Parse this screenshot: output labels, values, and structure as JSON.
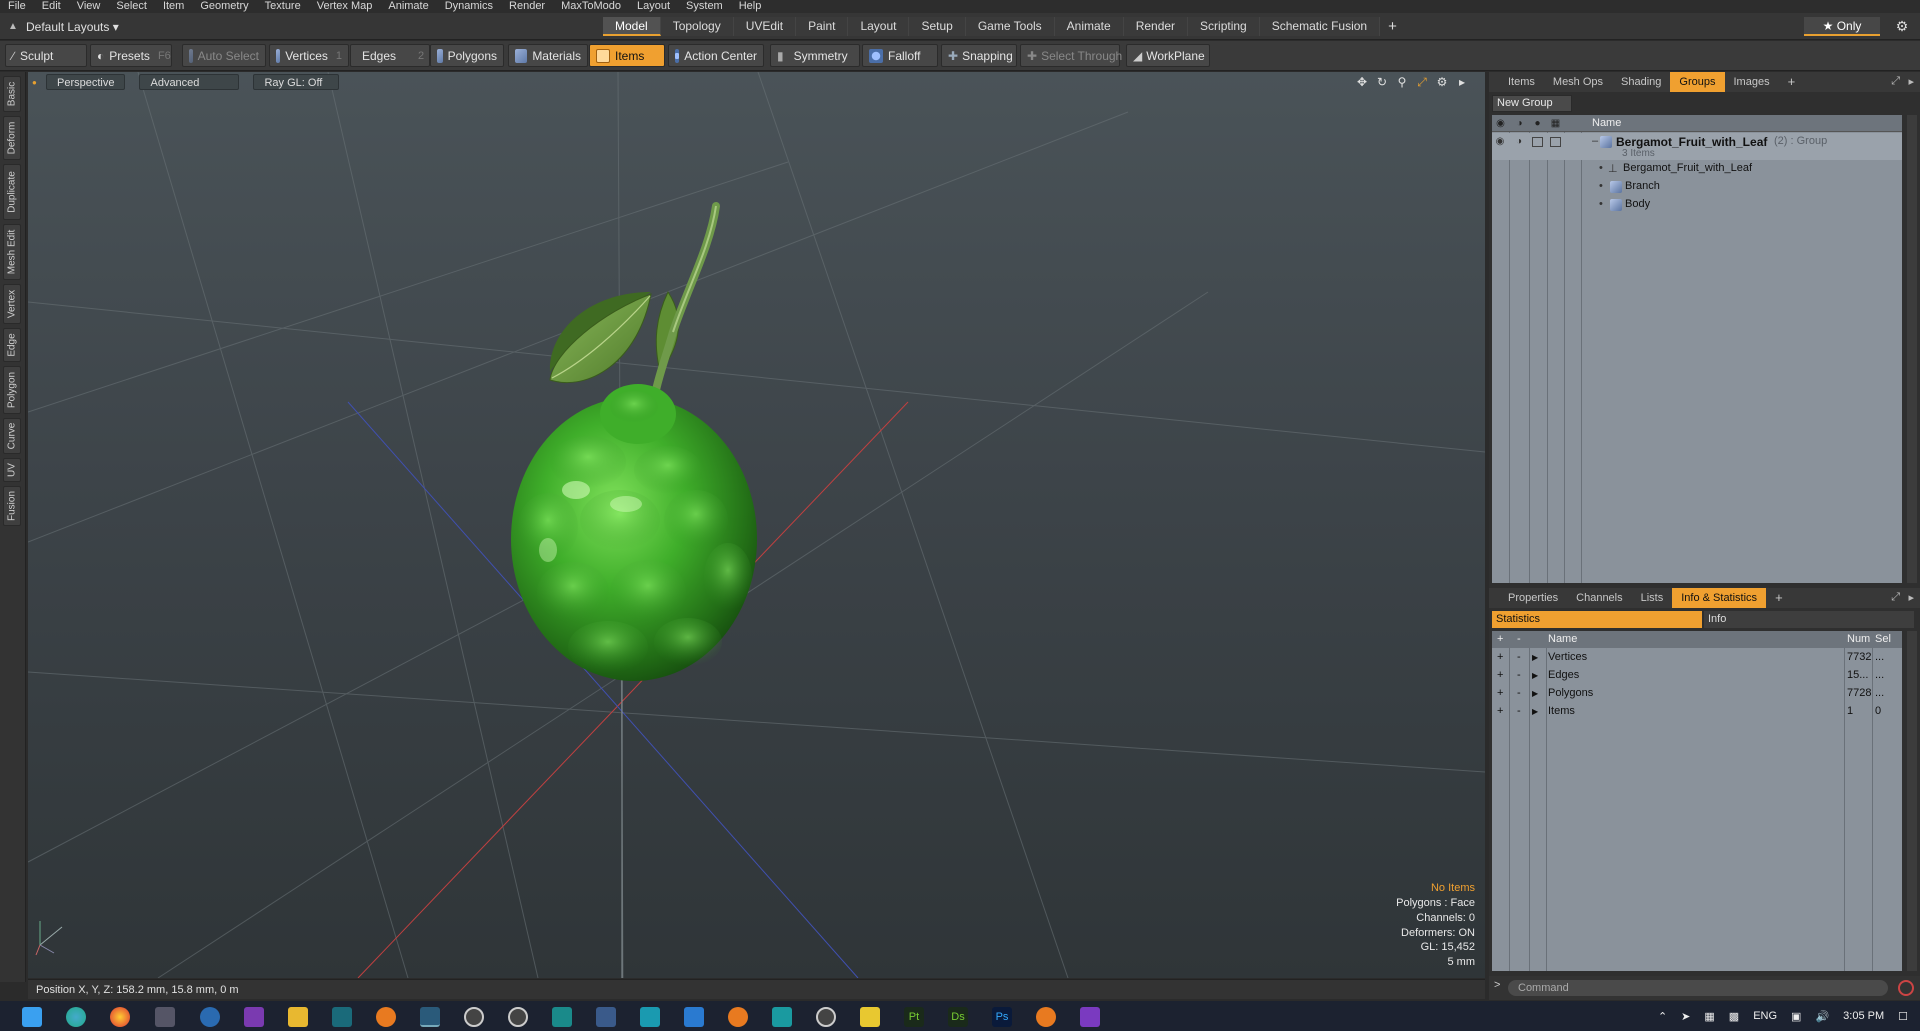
{
  "menu": [
    "File",
    "Edit",
    "View",
    "Select",
    "Item",
    "Geometry",
    "Texture",
    "Vertex Map",
    "Animate",
    "Dynamics",
    "Render",
    "MaxToModo",
    "Layout",
    "System",
    "Help"
  ],
  "layout": {
    "preset_label": "Default Layouts ▾",
    "tabs": [
      "Model",
      "Topology",
      "UVEdit",
      "Paint",
      "Layout",
      "Setup",
      "Game Tools",
      "Animate",
      "Render",
      "Scripting",
      "Schematic Fusion"
    ],
    "active_tab": "Model",
    "add_tab": "+",
    "only_label": "★  Only"
  },
  "toolbar": {
    "sculpt": "Sculpt",
    "presets": "Presets",
    "presets_key": "F6",
    "auto_select": "Auto Select",
    "vertices": "Vertices",
    "vertices_key": "1",
    "edges": "Edges",
    "edges_key": "2",
    "polygons": "Polygons",
    "materials": "Materials",
    "items": "Items",
    "action_center": "Action Center",
    "symmetry": "Symmetry",
    "falloff": "Falloff",
    "snapping": "Snapping",
    "select_through": "Select Through",
    "workplane": "WorkPlane"
  },
  "left_tabs": [
    "Basic",
    "Deform",
    "Duplicate",
    "Mesh Edit",
    "Vertex",
    "Edge",
    "Polygon",
    "Curve",
    "UV",
    "Fusion"
  ],
  "viewport": {
    "view_label": "Perspective",
    "shading_label": "Advanced",
    "raygl_label": "Ray GL: Off",
    "info": {
      "no_items": "No Items",
      "polygons": "Polygons : Face",
      "channels": "Channels: 0",
      "deformers": "Deformers: ON",
      "gl": "GL: 15,452",
      "scale": "5 mm"
    }
  },
  "status": {
    "position": "Position X, Y, Z:  158.2 mm, 15.8 mm, 0 m"
  },
  "groups_panel": {
    "tabs": [
      "Items",
      "Mesh Ops",
      "Shading",
      "Groups",
      "Images",
      "+"
    ],
    "active_tab": "Groups",
    "new_group": "New Group",
    "name_header": "Name",
    "group_name": "Bergamot_Fruit_with_Leaf",
    "group_suffix": "(2) : Group",
    "group_count": "3 Items",
    "children": [
      "Bergamot_Fruit_with_Leaf",
      "Branch",
      "Body"
    ]
  },
  "stats_panel": {
    "tabs": [
      "Properties",
      "Channels",
      "Lists",
      "Info & Statistics",
      "+"
    ],
    "active_tab": "Info & Statistics",
    "subtabs": [
      "Statistics",
      "Info"
    ],
    "headers": {
      "name": "Name",
      "num": "Num",
      "sel": "Sel"
    },
    "rows": [
      {
        "name": "Vertices",
        "num": "7732",
        "sel": "..."
      },
      {
        "name": "Edges",
        "num": "15...",
        "sel": "..."
      },
      {
        "name": "Polygons",
        "num": "7728",
        "sel": "..."
      },
      {
        "name": "Items",
        "num": "1",
        "sel": "0"
      }
    ],
    "plus": "+",
    "minus": "-"
  },
  "command": {
    "placeholder": "Command",
    "prompt": ">"
  },
  "taskbar": {
    "lang": "ENG",
    "time": "3:05 PM"
  },
  "colors": {
    "accent": "#f0a030",
    "viewport_top": "#4a5358",
    "viewport_bottom": "#2f3538",
    "fruit": "#3fae2a",
    "leaf": "#6e9a3e"
  }
}
